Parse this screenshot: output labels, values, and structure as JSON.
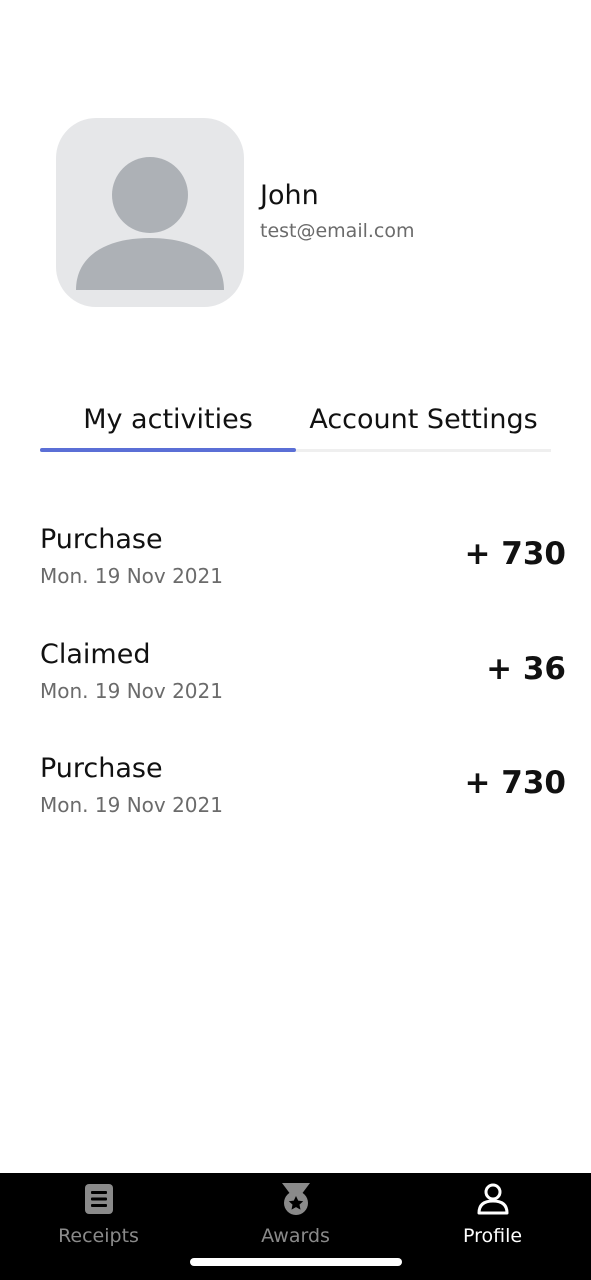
{
  "profile": {
    "name": "John",
    "email": "test@email.com",
    "avatar_icon": "default-user-avatar-icon"
  },
  "tabs": [
    {
      "label": "My activities",
      "active": true
    },
    {
      "label": "Account Settings",
      "active": false
    }
  ],
  "activities": [
    {
      "title": "Purchase",
      "date": "Mon. 19 Nov 2021",
      "points": "+ 730"
    },
    {
      "title": "Claimed",
      "date": "Mon. 19 Nov 2021",
      "points": "+ 36"
    },
    {
      "title": "Purchase",
      "date": "Mon. 19 Nov 2021",
      "points": "+ 730"
    }
  ],
  "bottom_nav": [
    {
      "label": "Receipts",
      "icon": "receipt-icon",
      "active": false
    },
    {
      "label": "Awards",
      "icon": "medal-icon",
      "active": false
    },
    {
      "label": "Profile",
      "icon": "person-icon",
      "active": true
    }
  ],
  "colors": {
    "accent": "#5b6fd6",
    "tab_bar_background": "#000000",
    "inactive_nav": "#8a8a8a",
    "active_nav": "#ffffff",
    "avatar_background": "#e6e7e9",
    "avatar_silhouette": "#adb1b6"
  }
}
